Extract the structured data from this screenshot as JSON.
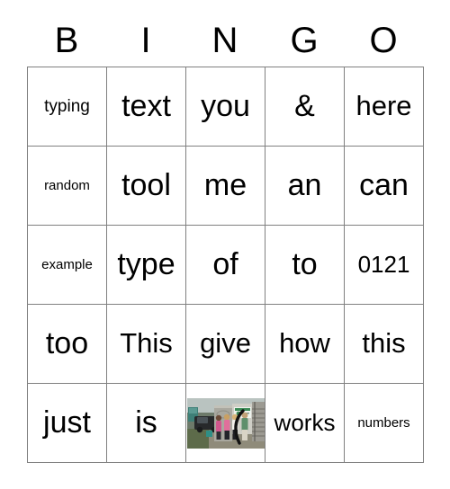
{
  "card": {
    "title": "BINGO",
    "header_letters": [
      "B",
      "I",
      "N",
      "G",
      "O"
    ],
    "columns": 5,
    "rows": 5,
    "border_color": "#808080",
    "text_color": "#000000",
    "background_color": "#ffffff",
    "grid": [
      [
        {
          "text": "typing",
          "size": "sm"
        },
        {
          "text": "text",
          "size": "xl"
        },
        {
          "text": "you",
          "size": "xl"
        },
        {
          "text": "&",
          "size": "xl"
        },
        {
          "text": "here",
          "size": "lg"
        }
      ],
      [
        {
          "text": "random",
          "size": "xs"
        },
        {
          "text": "tool",
          "size": "xl"
        },
        {
          "text": "me",
          "size": "xl"
        },
        {
          "text": "an",
          "size": "xl"
        },
        {
          "text": "can",
          "size": "xl"
        }
      ],
      [
        {
          "text": "example",
          "size": "xs"
        },
        {
          "text": "type",
          "size": "xl"
        },
        {
          "text": "of",
          "size": "xl"
        },
        {
          "text": "to",
          "size": "xl"
        },
        {
          "text": "0121",
          "size": "md"
        }
      ],
      [
        {
          "text": "too",
          "size": "xl"
        },
        {
          "text": "This",
          "size": "lg"
        },
        {
          "text": "give",
          "size": "lg"
        },
        {
          "text": "how",
          "size": "lg"
        },
        {
          "text": "this",
          "size": "lg"
        }
      ],
      [
        {
          "text": "just",
          "size": "xl"
        },
        {
          "text": "is",
          "size": "xl"
        },
        {
          "text": "",
          "size": "md",
          "image": "group-photo"
        },
        {
          "text": "works",
          "size": "md"
        },
        {
          "text": "numbers",
          "size": "xs"
        }
      ]
    ]
  }
}
